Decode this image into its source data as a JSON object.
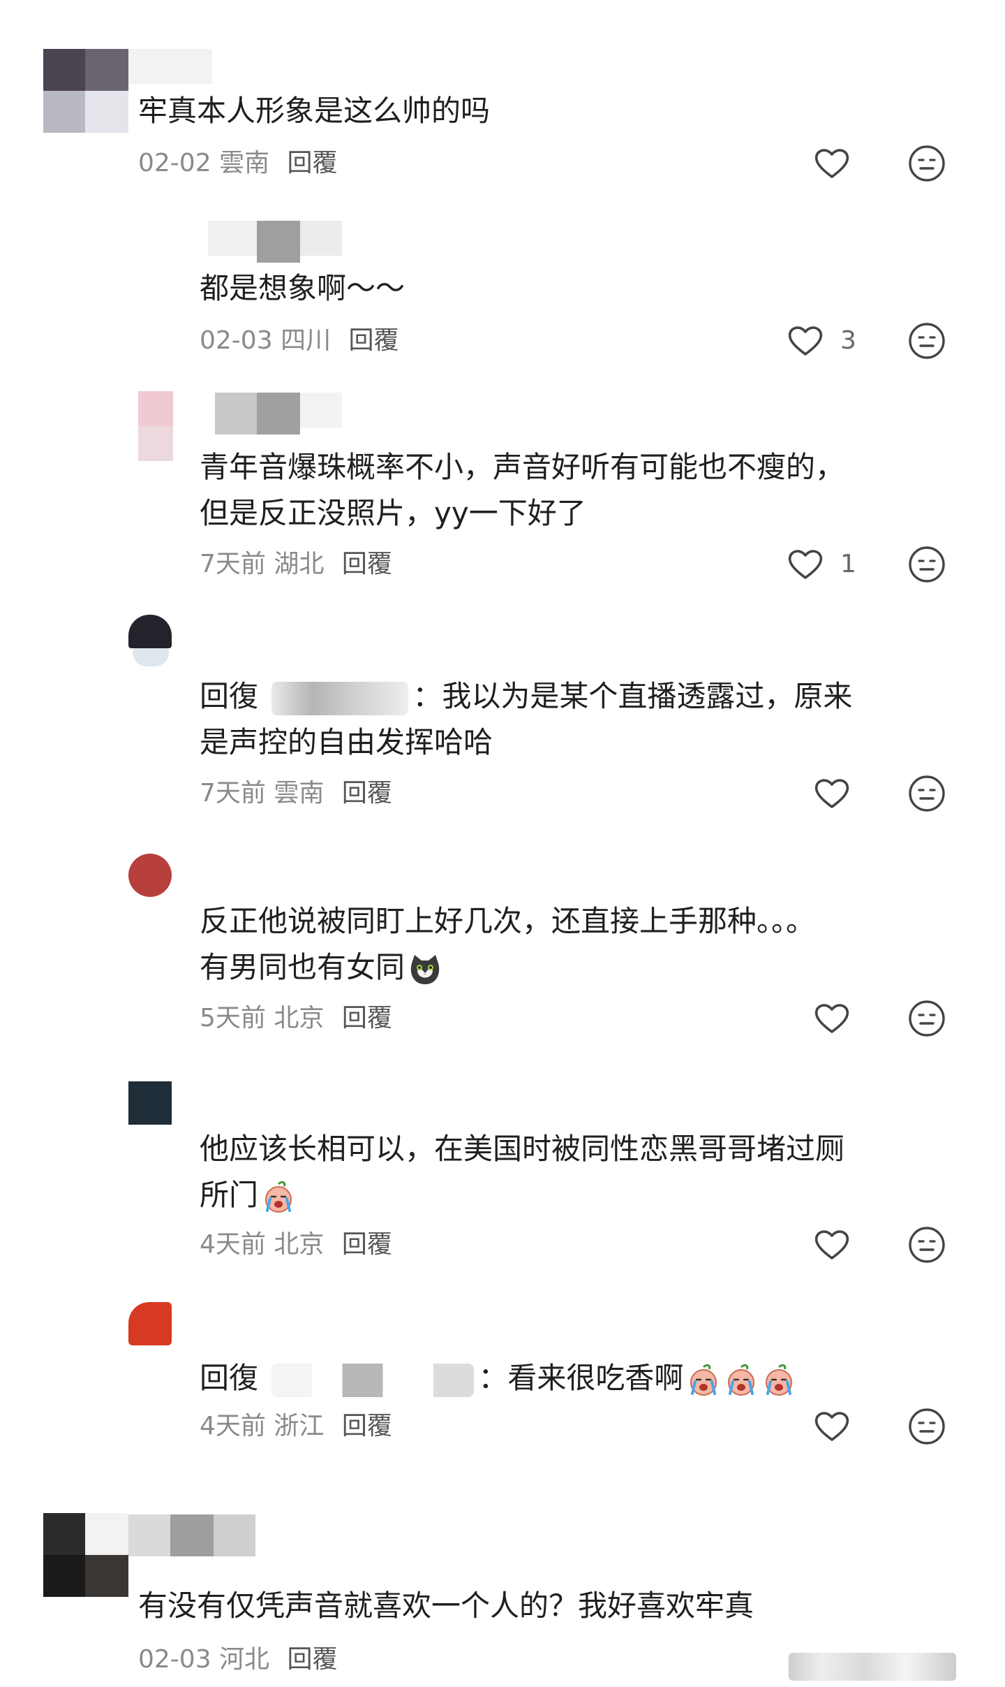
{
  "reply_prefix": "回復",
  "reply_label": "回覆",
  "comments": [
    {
      "text": "牢真本人形象是这么帅的吗",
      "date": "02-02",
      "region": "雲南",
      "reply": "回覆",
      "likes": ""
    },
    {
      "text": "都是想象啊～～",
      "date": "02-03",
      "region": "四川",
      "reply": "回覆",
      "likes": "3"
    },
    {
      "text_line1": "青年音爆珠概率不小，声音好听有可能也不瘦的，",
      "text_line2": "但是反正没照片，yy一下好了",
      "date": "7天前",
      "region": "湖北",
      "reply": "回覆",
      "likes": "1"
    },
    {
      "reply_prefix": "回復",
      "text_line1": "：我以为是某个直播透露过，原来",
      "text_line2": "是声控的自由发挥哈哈",
      "date": "7天前",
      "region": "雲南",
      "reply": "回覆",
      "likes": ""
    },
    {
      "text_line1": "反正他说被同盯上好几次，还直接上手那种。。。",
      "text_line2": "有男同也有女同",
      "emoji": "cat-emoji",
      "date": "5天前",
      "region": "北京",
      "reply": "回覆",
      "likes": ""
    },
    {
      "text_line1": "他应该长相可以，在美国时被同性恋黑哥哥堵过厕",
      "text_line2": "所门",
      "emoji": "crying-peach-emoji",
      "date": "4天前",
      "region": "北京",
      "reply": "回覆",
      "likes": ""
    },
    {
      "reply_prefix": "回復",
      "text": "：看来很吃香啊",
      "emoji": "crying-peach-emoji",
      "date": "4天前",
      "region": "浙江",
      "reply": "回覆",
      "likes": ""
    },
    {
      "text": "有没有仅凭声音就喜欢一个人的？我好喜欢牢真",
      "date": "02-03",
      "region": "河北",
      "reply": "回覆",
      "likes": ""
    }
  ],
  "icons": {
    "like": "heart-outline-icon",
    "dislike": "meh-face-icon"
  },
  "colors": {
    "text": "#1f1f1f",
    "meta": "#8a8a8a",
    "icon": "#444444"
  }
}
